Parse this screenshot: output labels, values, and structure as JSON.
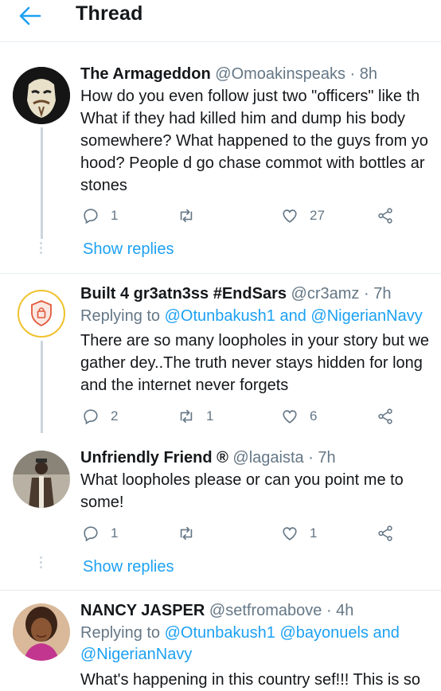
{
  "header": {
    "title": "Thread"
  },
  "tweets": [
    {
      "name": "The Armageddon",
      "handle": "@Omoakinspeaks · 8h",
      "lines": [
        "How do you even follow just two \"officers\" like th",
        "What if they had killed him and dump his body",
        "somewhere? What happened to the guys from yo",
        "hood? People d go chase commot with bottles ar",
        "stones"
      ],
      "replies": "1",
      "retweets": "",
      "likes": "27",
      "show_replies": "Show replies"
    },
    {
      "name": "Built 4 gr3atn3ss #EndSars",
      "handle": "@cr3amz · 7h",
      "reply_prefix": "Replying to",
      "reply_mentions": "@Otunbakush1 and @NigerianNavy",
      "lines": [
        "There are so many loopholes in your story but we",
        "gather dey..The truth never stays hidden for long",
        "and the internet never forgets"
      ],
      "replies": "2",
      "retweets": "1",
      "likes": "6"
    },
    {
      "name": "Unfriendly Friend ®",
      "handle": "@lagaista · 7h",
      "lines": [
        "What loopholes please or can you point me to",
        "some!"
      ],
      "replies": "1",
      "retweets": "",
      "likes": "1",
      "show_replies": "Show replies"
    },
    {
      "name": "NANCY JASPER",
      "handle": "@setfromabove · 4h",
      "reply_prefix": "Replying to",
      "reply_mentions_1": "@Otunbakush1 @bayonuels and",
      "reply_mentions_2": "@NigerianNavy",
      "lines": [
        "What's happening in this country sef!!! This is so"
      ]
    }
  ],
  "icons": {
    "back": "arrow-left-icon",
    "reply": "reply-icon",
    "retweet": "retweet-icon",
    "like": "heart-icon",
    "share": "share-icon"
  },
  "colors": {
    "accent": "#1da1f2",
    "muted": "#657786",
    "divider": "#e6ecf0"
  }
}
